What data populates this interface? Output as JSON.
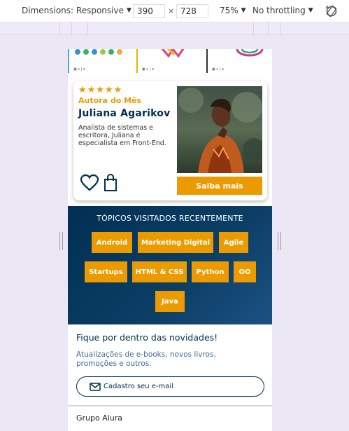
{
  "devtools": {
    "dimensions_label": "Dimensions: Responsive",
    "width_value": "390",
    "times": "×",
    "height_value": "728",
    "zoom_label": "75%",
    "throttle_label": "No throttling"
  },
  "author_card": {
    "stars": "★★★★★",
    "label": "Autora do Mês",
    "name": "Juliana Agarikov",
    "description": "Analista de sistemas e escritora, Juliana é especialista em Front-End.",
    "cta_label": "Saiba mais"
  },
  "topics": {
    "title": "TÓPICOS VISITADOS RECENTEMENTE",
    "tags": [
      "Android",
      "Marketing Digital",
      "Agile",
      "Startups",
      "HTML & CSS",
      "Python",
      "OO",
      "Java"
    ]
  },
  "newsletter": {
    "title": "Fique por dentro das novidades!",
    "description": "Atualizações de e-books, novos livros, promoções e outros.",
    "button_label": "Cadastro seu e-mail"
  },
  "footer": {
    "company": "Grupo Alura"
  },
  "colors": {
    "accent": "#eb9b00",
    "navy": "#002f52"
  }
}
